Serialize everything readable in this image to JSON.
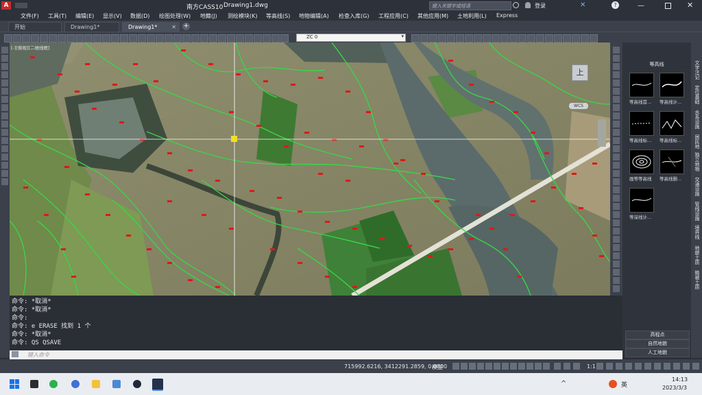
{
  "titlebar": {
    "app_title": "南方CASS10",
    "file_name": "Drawing1.dwg",
    "search_placeholder": "键入关键字或短语",
    "login_label": "登录"
  },
  "menu": {
    "items": [
      "文件(F)",
      "工具(T)",
      "编辑(E)",
      "显示(V)",
      "数据(D)",
      "绘图处理(W)",
      "地籍(J)",
      "测绘模块(K)",
      "等高线(S)",
      "地物编辑(A)",
      "检查入库(G)",
      "工程应用(C)",
      "其他应用(M)",
      "土地利用(L)",
      "Express"
    ]
  },
  "tabs": {
    "items": [
      "开始",
      "Drawing1*",
      "Drawing1*"
    ]
  },
  "toolbar": {
    "layer_value": "ZC 0"
  },
  "viewport": {
    "view_label": "[-][俯视][二维线框]",
    "compass_top": "上",
    "wcs_label": "WCS"
  },
  "panel": {
    "title": "等高线",
    "thumbnails": [
      "等高线首...",
      "等高线计...",
      "等高线标...",
      "等高线标...",
      "画等等高线",
      "等高线删...",
      "等深线计..."
    ],
    "buttons": [
      "高程点",
      "自然地貌",
      "人工地貌"
    ]
  },
  "side_tabs": [
    "文字注记",
    "定位基础",
    "水系设施",
    "居民地",
    "独立地物",
    "交通设施",
    "管线设施",
    "境界线",
    "地貌土质",
    "植被土质"
  ],
  "command": {
    "history": [
      "命令: *取消*",
      "命令: *取消*",
      "命令:",
      "命令: e ERASE 找到 1 个",
      "命令: *取消*",
      "命令: QS QSAVE"
    ],
    "input_placeholder": "键入命令"
  },
  "status": {
    "coords": "715992.6216, 3412291.2859, 0.0000",
    "mode": "模型",
    "scale": "1:1"
  },
  "taskbar": {
    "ime": "英",
    "time": "14:13",
    "date": "2023/3/3"
  },
  "colors": {
    "accent": "#d23a3a",
    "contour_green": "#39d54a",
    "crosshair": "#ffffff",
    "marker_red": "#e01818",
    "snap_yellow": "#f0e020"
  },
  "icons": [
    "cass-logo-icon",
    "search-icon",
    "user-icon",
    "exchange-icon",
    "help-icon",
    "minimize-icon",
    "maximize-icon",
    "close-icon",
    "start-icon",
    "chrome-icon",
    "file-explorer-icon",
    "windows-store-icon"
  ]
}
